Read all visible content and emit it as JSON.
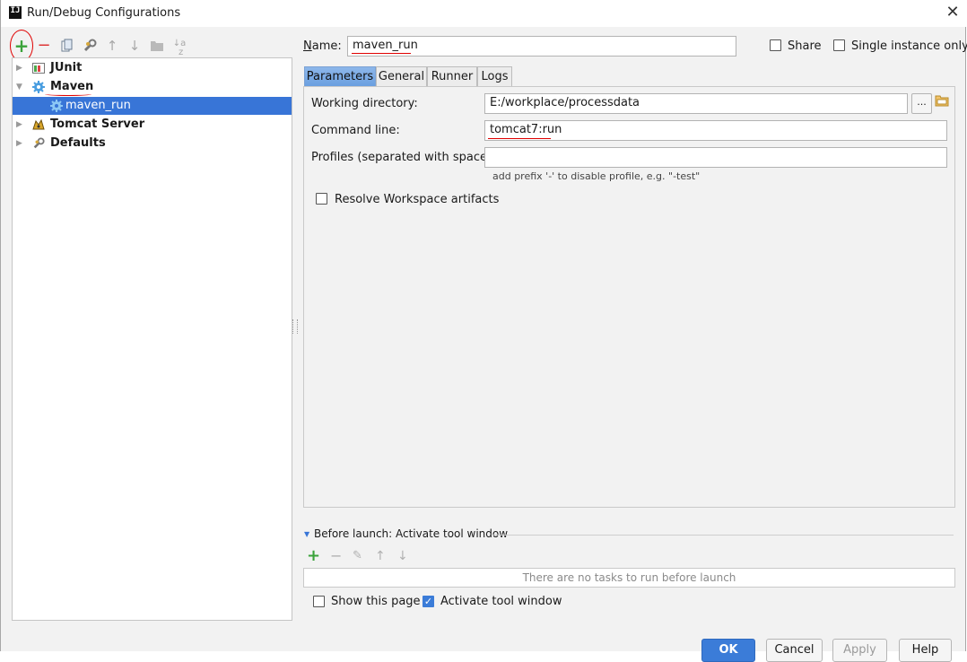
{
  "window": {
    "title": "Run/Debug Configurations",
    "app_icon": "IJ"
  },
  "toolbar": {
    "add": "+",
    "remove": "−",
    "copy": "copy-icon",
    "edit_defaults": "wrench-icon",
    "move_up": "↑",
    "move_down": "↓",
    "folder": "folder-icon",
    "sort": "sort-icon"
  },
  "tree": {
    "items": [
      {
        "label": "JUnit",
        "expanded": false
      },
      {
        "label": "Maven",
        "expanded": true
      },
      {
        "label": "maven_run",
        "selected": true
      },
      {
        "label": "Tomcat Server",
        "expanded": false
      },
      {
        "label": "Defaults",
        "expanded": false
      }
    ]
  },
  "header": {
    "name_label": "Name:",
    "name_value": "maven_run",
    "share_label": "Share",
    "share_checked": false,
    "single_instance_label": "Single instance only",
    "single_instance_checked": false
  },
  "tabs": [
    "Parameters",
    "General",
    "Runner",
    "Logs"
  ],
  "active_tab": "Parameters",
  "parameters": {
    "working_dir_label": "Working directory:",
    "working_dir_value": "E:/workplace/processdata",
    "browse_label": "...",
    "command_line_label": "Command line:",
    "command_line_value": "tomcat7:run",
    "profiles_label": "Profiles (separated with space):",
    "profiles_value": "",
    "profiles_hint": "add prefix '-' to disable profile, e.g. \"-test\"",
    "resolve_label": "Resolve Workspace artifacts",
    "resolve_checked": false
  },
  "before_launch": {
    "title": "Before launch: Activate tool window",
    "empty_text": "There are no tasks to run before launch"
  },
  "footer": {
    "show_page_label": "Show this page",
    "show_page_checked": false,
    "activate_tool_label": "Activate tool window",
    "activate_tool_checked": true
  },
  "buttons": {
    "ok": "OK",
    "cancel": "Cancel",
    "apply": "Apply",
    "help": "Help"
  },
  "colors": {
    "selection": "#3875d7",
    "accent": "#3b7cd8",
    "annotation": "#e00000",
    "add_green": "#3aa33a"
  }
}
